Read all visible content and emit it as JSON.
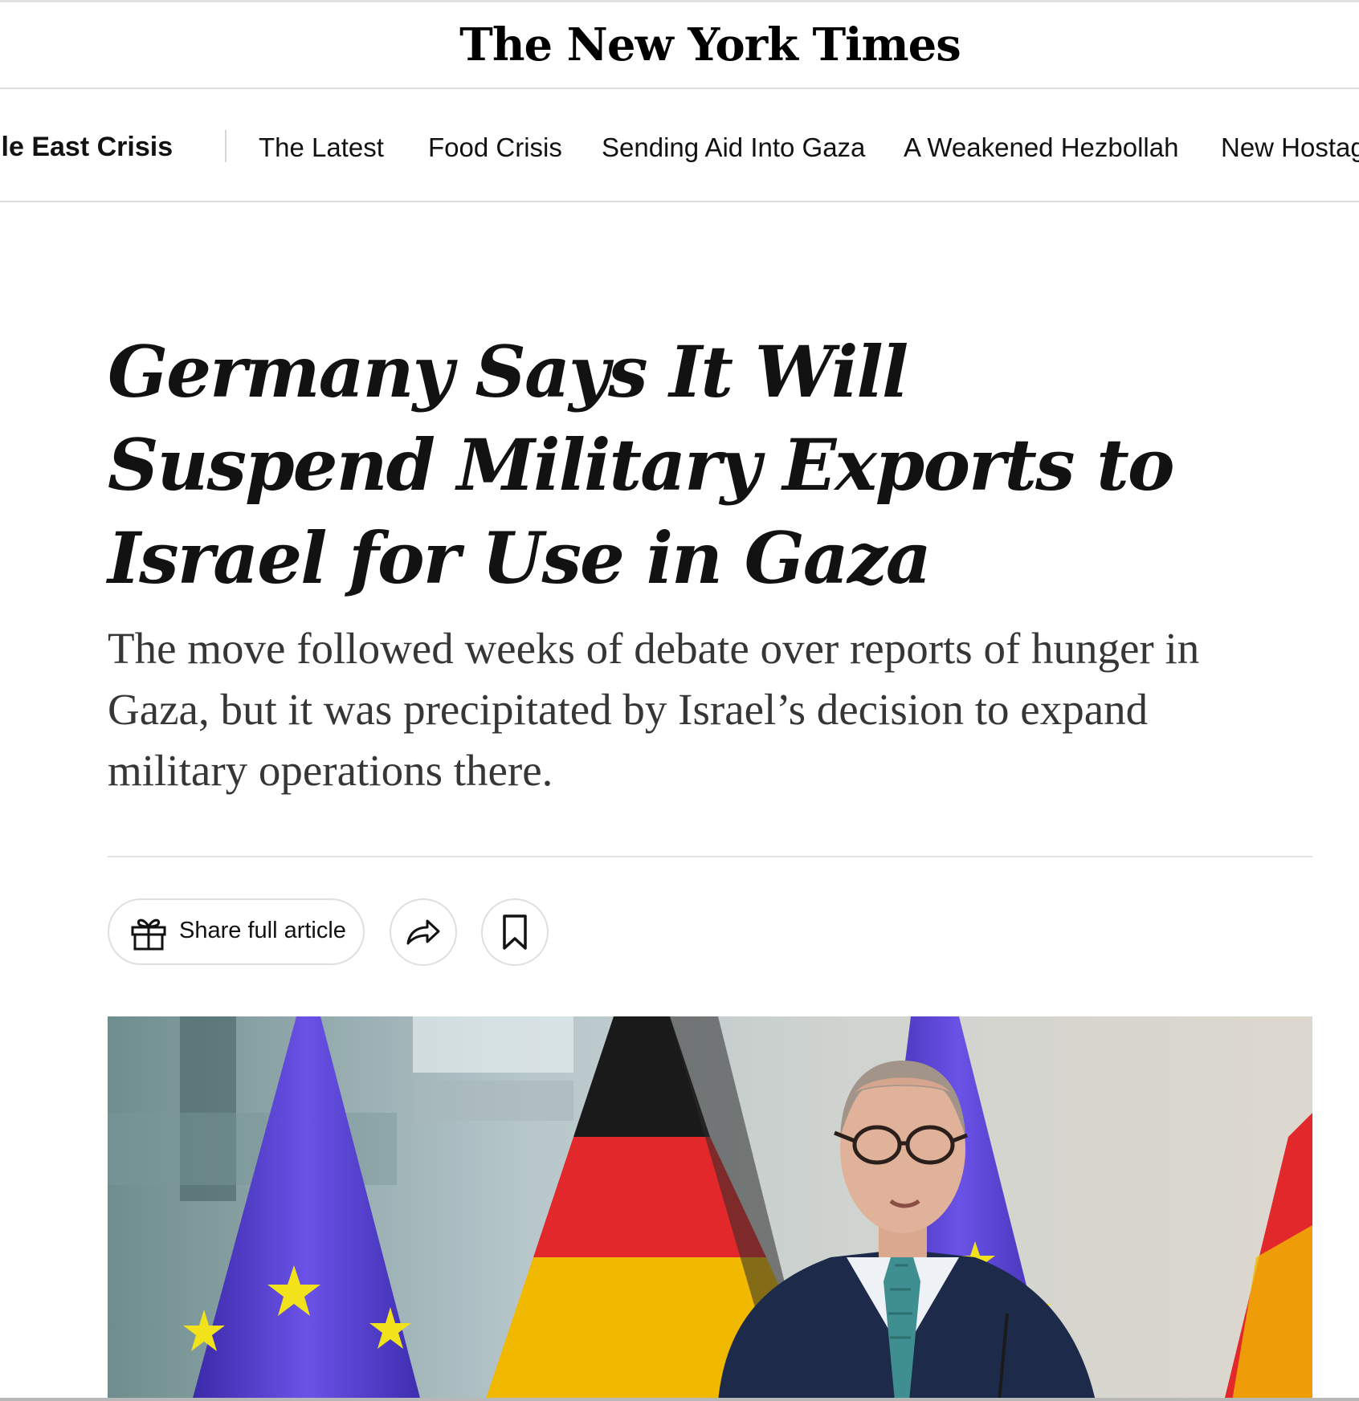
{
  "masthead": {
    "logo_text": "The New York Times"
  },
  "subnav": {
    "section": "ddle East Crisis",
    "items": [
      "The Latest",
      "Food Crisis",
      "Sending Aid Into Gaza",
      "A Weakened Hezbollah",
      "New Hostag"
    ]
  },
  "article": {
    "headline": "Germany Says It Will Suspend Military Exports to Israel for Use in Gaza",
    "summary": "The move followed weeks of debate over reports of hunger in Gaza, but it was precipitated by Israel’s decision to expand military operations there."
  },
  "actions": {
    "share_label": "Share full article",
    "share_icon": "gift-icon",
    "forward_icon": "share-arrow-icon",
    "save_icon": "bookmark-icon"
  },
  "colors": {
    "text": "#121212",
    "summary_text": "#363636",
    "divider": "#e2e2e2",
    "eu_blue": "#5a3fd6",
    "eu_star": "#f2e21b",
    "de_black": "#1a1a1a",
    "de_red": "#e3282b",
    "de_gold": "#f5c400",
    "suit": "#1d2a4a"
  }
}
